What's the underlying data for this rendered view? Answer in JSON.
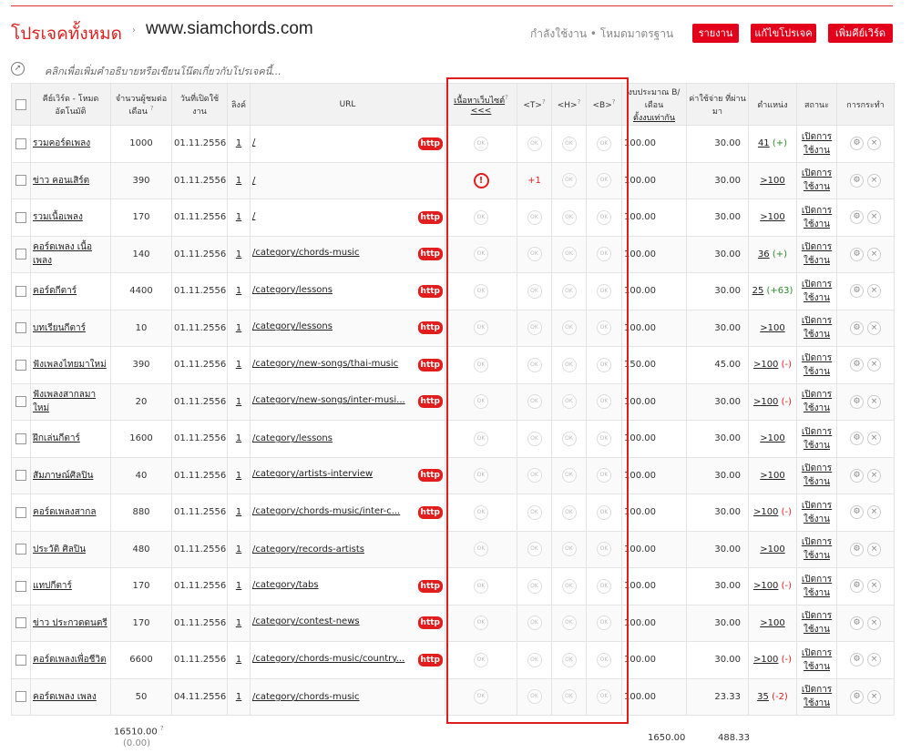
{
  "header": {
    "project_label": "โปรเจคทั้งหมด",
    "breadcrumb_sep": "›",
    "site": "www.siamchords.com",
    "status": "กำลังใช้งาน  •  โหมดมาตรฐาน",
    "btn_report": "รายงาน",
    "btn_edit": "แก้ไขโปรเจค",
    "btn_add": "เพิ่มคีย์เวิร์ด"
  },
  "desc": {
    "icon": "compass-icon",
    "text": "คลิกเพื่อเพิ่มคำอธิบายหรือเขียนโน๊ตเกี่ยวกับโปรเจคนี้..."
  },
  "columns": {
    "keyword": "คีย์เวิร์ด - โหมดอัตโนมัติ",
    "searches": "จำนวนผู้ชมต่อเดือน",
    "date": "วันที่เปิดใช้งาน",
    "link": "ลิงค์",
    "url": "URL",
    "content": "เนื้อหาเว็บไซต์",
    "content_link": "<<<",
    "t": "<T>",
    "h": "<H>",
    "b": "<B>",
    "budget": "งบประมาณ B/เดือน",
    "budget_link": "ตั้งงบเท่ากัน",
    "cost": "ค่าใช้จ่าย ที่ผ่านมา",
    "position": "ตำแหน่ง",
    "status": "สถานะ",
    "action": "การกระทำ",
    "help": "?"
  },
  "rows": [
    {
      "kw": "รวมคอร์ดเพลง",
      "n": "1000",
      "d": "01.11.2556",
      "l": "1",
      "url": "/",
      "http": true,
      "warn": false,
      "t": "",
      "budget": "100.00",
      "cost": "30.00",
      "pos": "41",
      "chg": "(+)",
      "chgc": "green",
      "st": "เปิดการใช้งาน"
    },
    {
      "kw": "ข่าว คอนเสิร์ต",
      "n": "390",
      "d": "01.11.2556",
      "l": "1",
      "url": "/",
      "http": false,
      "warn": true,
      "t": "+1",
      "budget": "100.00",
      "cost": "30.00",
      "pos": ">100",
      "chg": "",
      "chgc": "",
      "st": "เปิดการใช้งาน"
    },
    {
      "kw": "รวมเนื้อเพลง",
      "n": "170",
      "d": "01.11.2556",
      "l": "1",
      "url": "/",
      "http": true,
      "warn": false,
      "t": "",
      "budget": "100.00",
      "cost": "30.00",
      "pos": ">100",
      "chg": "",
      "chgc": "",
      "st": "เปิดการใช้งาน"
    },
    {
      "kw": "คอร์ดเพลง เนื้อเพลง",
      "n": "140",
      "d": "01.11.2556",
      "l": "1",
      "url": "/category/chords-music",
      "http": true,
      "warn": false,
      "t": "",
      "budget": "100.00",
      "cost": "30.00",
      "pos": "36",
      "chg": "(+)",
      "chgc": "green",
      "st": "เปิดการใช้งาน"
    },
    {
      "kw": "คอร์ดกีตาร์",
      "n": "4400",
      "d": "01.11.2556",
      "l": "1",
      "url": "/category/lessons",
      "http": true,
      "warn": false,
      "t": "",
      "budget": "100.00",
      "cost": "30.00",
      "pos": "25",
      "chg": "(+63)",
      "chgc": "green",
      "st": "เปิดการใช้งาน"
    },
    {
      "kw": "บทเรียนกีตาร์",
      "n": "10",
      "d": "01.11.2556",
      "l": "1",
      "url": "/category/lessons",
      "http": true,
      "warn": false,
      "t": "",
      "budget": "100.00",
      "cost": "30.00",
      "pos": ">100",
      "chg": "",
      "chgc": "",
      "st": "เปิดการใช้งาน"
    },
    {
      "kw": "ฟังเพลงไทยมาใหม่",
      "n": "390",
      "d": "01.11.2556",
      "l": "1",
      "url": "/category/new-songs/thai-music",
      "http": true,
      "warn": false,
      "t": "",
      "budget": "150.00",
      "cost": "45.00",
      "pos": ">100",
      "chg": "(-)",
      "chgc": "red",
      "st": "เปิดการใช้งาน"
    },
    {
      "kw": "ฟังเพลงสากลมาใหม่",
      "n": "20",
      "d": "01.11.2556",
      "l": "1",
      "url": "/category/new-songs/inter-musi...",
      "http": true,
      "warn": false,
      "t": "",
      "budget": "100.00",
      "cost": "30.00",
      "pos": ">100",
      "chg": "(-)",
      "chgc": "red",
      "st": "เปิดการใช้งาน"
    },
    {
      "kw": "ฝึกเล่นกีตาร์",
      "n": "1600",
      "d": "01.11.2556",
      "l": "1",
      "url": "/category/lessons",
      "http": false,
      "warn": false,
      "t": "",
      "budget": "100.00",
      "cost": "30.00",
      "pos": ">100",
      "chg": "",
      "chgc": "",
      "st": "เปิดการใช้งาน"
    },
    {
      "kw": "สัมภาษณ์ศิลปิน",
      "n": "40",
      "d": "01.11.2556",
      "l": "1",
      "url": "/category/artists-interview",
      "http": true,
      "warn": false,
      "t": "",
      "budget": "100.00",
      "cost": "30.00",
      "pos": ">100",
      "chg": "",
      "chgc": "",
      "st": "เปิดการใช้งาน"
    },
    {
      "kw": "คอร์ดเพลงสากล",
      "n": "880",
      "d": "01.11.2556",
      "l": "1",
      "url": "/category/chords-music/inter-c...",
      "http": true,
      "warn": false,
      "t": "",
      "budget": "100.00",
      "cost": "30.00",
      "pos": ">100",
      "chg": "(-)",
      "chgc": "red",
      "st": "เปิดการใช้งาน"
    },
    {
      "kw": "ประวัติ ศิลปิน",
      "n": "480",
      "d": "01.11.2556",
      "l": "1",
      "url": "/category/records-artists",
      "http": false,
      "warn": false,
      "t": "",
      "budget": "100.00",
      "cost": "30.00",
      "pos": ">100",
      "chg": "",
      "chgc": "",
      "st": "เปิดการใช้งาน"
    },
    {
      "kw": "แทปกีตาร์",
      "n": "170",
      "d": "01.11.2556",
      "l": "1",
      "url": "/category/tabs",
      "http": true,
      "warn": false,
      "t": "",
      "budget": "100.00",
      "cost": "30.00",
      "pos": ">100",
      "chg": "(-)",
      "chgc": "red",
      "st": "เปิดการใช้งาน"
    },
    {
      "kw": "ข่าว ประกวดดนตรี",
      "n": "170",
      "d": "01.11.2556",
      "l": "1",
      "url": "/category/contest-news",
      "http": true,
      "warn": false,
      "t": "",
      "budget": "100.00",
      "cost": "30.00",
      "pos": ">100",
      "chg": "",
      "chgc": "",
      "st": "เปิดการใช้งาน"
    },
    {
      "kw": "คอร์ดเพลงเพื่อชีวิต",
      "n": "6600",
      "d": "01.11.2556",
      "l": "1",
      "url": "/category/chords-music/country...",
      "http": true,
      "warn": false,
      "t": "",
      "budget": "100.00",
      "cost": "30.00",
      "pos": ">100",
      "chg": "(-)",
      "chgc": "red",
      "st": "เปิดการใช้งาน"
    },
    {
      "kw": "คอร์ดเพลง เพลง",
      "n": "50",
      "d": "04.11.2556",
      "l": "1",
      "url": "/category/chords-music",
      "http": false,
      "warn": false,
      "t": "",
      "budget": "100.00",
      "cost": "23.33",
      "pos": "35",
      "chg": "(-2)",
      "chgc": "red",
      "st": "เปิดการใช้งาน"
    }
  ],
  "labels": {
    "ok": "OK",
    "http": "http",
    "warn": "!",
    "gear": "⚙",
    "close": "×"
  },
  "totals": {
    "searches": "16510.00",
    "searches_sub": "(0.00)",
    "budget": "1650.00",
    "cost": "488.33"
  }
}
